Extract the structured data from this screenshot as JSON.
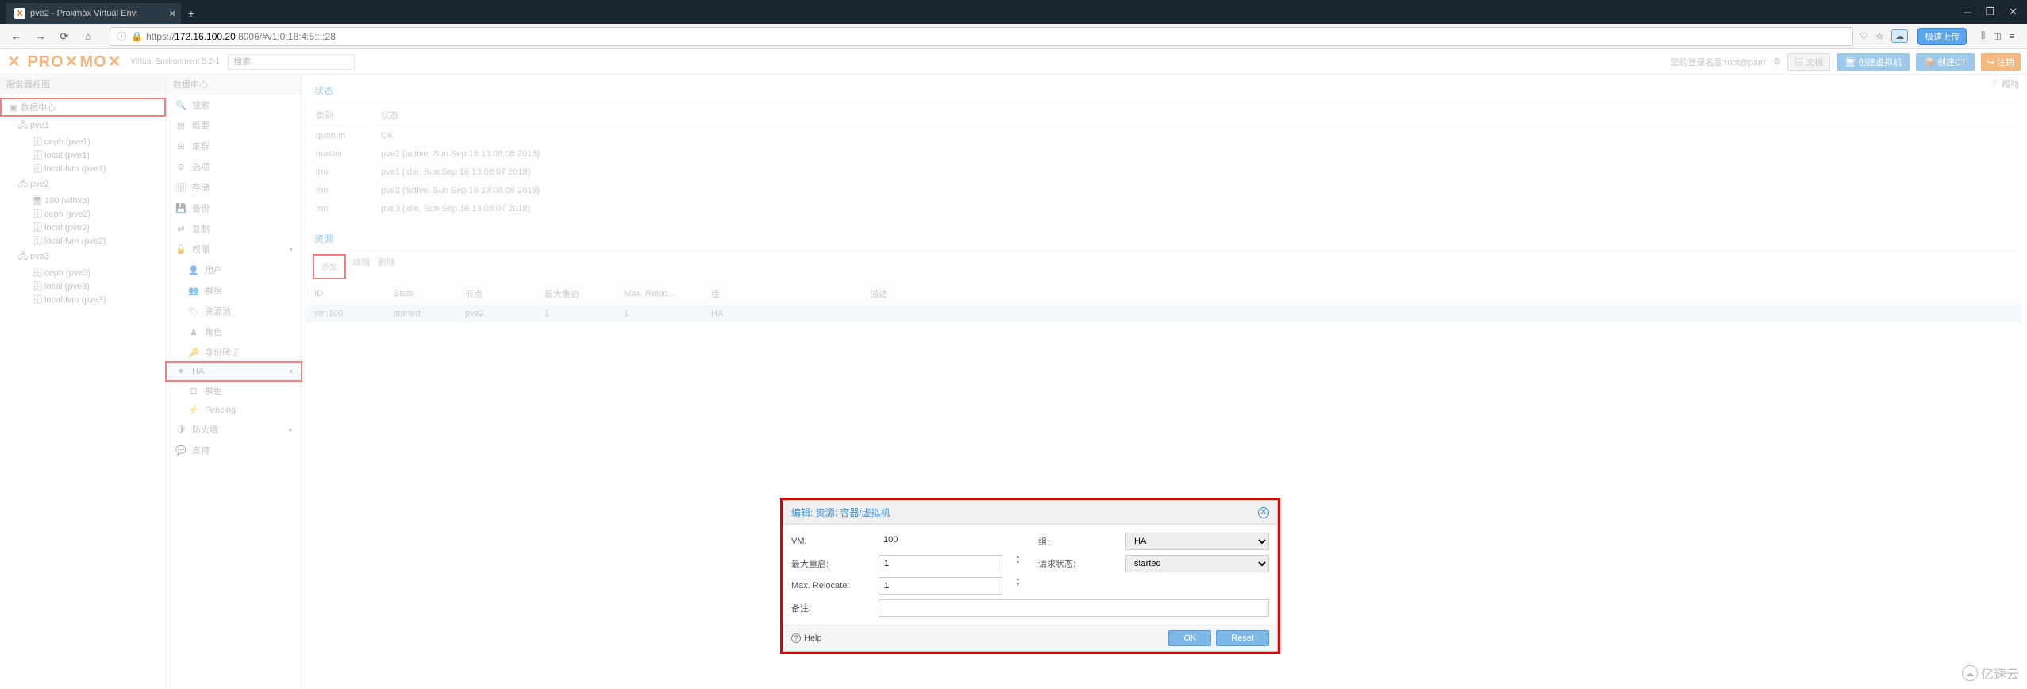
{
  "browser": {
    "tab_title": "pve2 - Proxmox Virtual Envi",
    "url_host": "172.16.100.20",
    "url_port_path": ":8006/#v1:0:18:4:5::::28",
    "url_prefix": "https://",
    "badge": "极速上传"
  },
  "header": {
    "version": "Virtual Environment 5.2-1",
    "search_placeholder": "搜索",
    "login_info": "您的登录名是'root@pam'",
    "docs": "文档",
    "create_vm": "创建虚拟机",
    "create_ct": "创建CT",
    "logout": "注销"
  },
  "left": {
    "title": "服务器视图",
    "root": "数据中心",
    "pve1": {
      "name": "pve1",
      "items": [
        "ceph (pve1)",
        "local (pve1)",
        "local-lvm (pve1)"
      ]
    },
    "pve2": {
      "name": "pve2",
      "vm": "100 (winxp)",
      "items": [
        "ceph (pve2)",
        "local (pve2)",
        "local-lvm (pve2)"
      ]
    },
    "pve3": {
      "name": "pve3",
      "items": [
        "ceph (pve3)",
        "local (pve3)",
        "local-lvm (pve3)"
      ]
    }
  },
  "midmenu": {
    "title": "数据中心",
    "items": {
      "search": "搜索",
      "summary": "概要",
      "cluster": "集群",
      "options": "选项",
      "storage": "存储",
      "backup": "备份",
      "replication": "复制",
      "permissions": "权限",
      "users": "用户",
      "groups": "群组",
      "pools": "资源池",
      "roles": "角色",
      "auth": "身份验证",
      "ha": "HA",
      "ha_groups": "群组",
      "fencing": "Fencing",
      "firewall": "防火墙",
      "support": "支持"
    }
  },
  "content": {
    "help": "帮助",
    "status_title": "状态",
    "status_cols": {
      "type": "类别",
      "status": "状态"
    },
    "status_rows": [
      {
        "t": "quorum",
        "s": "OK"
      },
      {
        "t": "master",
        "s": "pve2 (active, Sun Sep 16 13:08:06 2018)"
      },
      {
        "t": "lrm",
        "s": "pve1 (idle, Sun Sep 16 13:08:07 2018)"
      },
      {
        "t": "lrm",
        "s": "pve2 (active, Sun Sep 16 13:08:06 2018)"
      },
      {
        "t": "lrm",
        "s": "pve3 (idle, Sun Sep 16 13:08:07 2018)"
      }
    ],
    "resource_title": "资源",
    "toolbar": {
      "add": "添加",
      "edit": "编辑",
      "delete": "删除"
    },
    "res_cols": {
      "id": "ID",
      "state": "State",
      "node": "节点",
      "maxrestart": "最大重启",
      "maxreloc": "Max. Reloc...",
      "group": "组",
      "desc": "描述"
    },
    "res_row": {
      "id": "vm:100",
      "state": "started",
      "node": "pve2",
      "maxrestart": "1",
      "maxreloc": "1",
      "group": "HA",
      "desc": ""
    }
  },
  "dialog": {
    "title": "编辑: 资源: 容器/虚拟机",
    "vm_label": "VM:",
    "vm_val": "100",
    "group_label": "组:",
    "group_val": "HA",
    "maxrestart_label": "最大重启:",
    "maxrestart_val": "1",
    "reqstate_label": "请求状态:",
    "reqstate_val": "started",
    "maxreloc_label": "Max. Relocate:",
    "maxreloc_val": "1",
    "note_label": "备注:",
    "note_val": "",
    "help": "Help",
    "ok": "OK",
    "reset": "Reset"
  },
  "watermark": "亿速云"
}
